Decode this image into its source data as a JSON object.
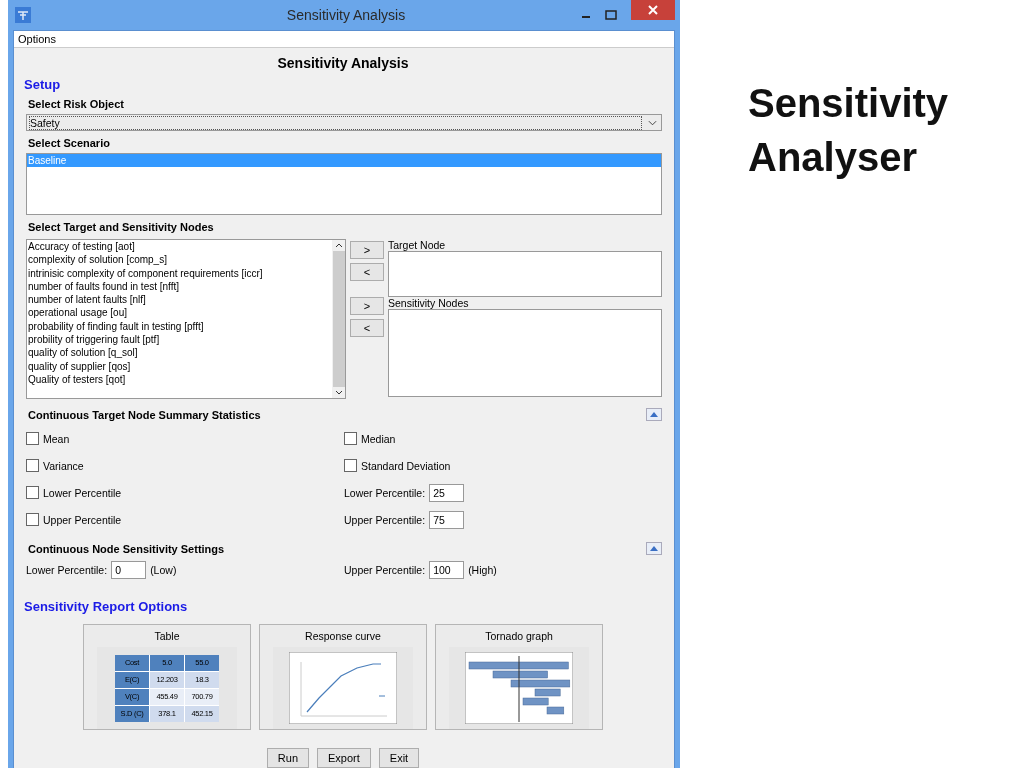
{
  "window": {
    "title": "Sensitivity Analysis"
  },
  "menu": [
    "Options"
  ],
  "heading": "Sensitivity Analysis",
  "setup": {
    "title": "Setup",
    "risk_object": {
      "label": "Select Risk Object",
      "value": "Safety"
    },
    "scenario": {
      "label": "Select Scenario",
      "items": [
        {
          "label": "Baseline",
          "selected": true
        }
      ]
    },
    "nodes_label": "Select Target and Sensitivity Nodes",
    "nodes": [
      "Accuracy of testing [aot]",
      "complexity of solution [comp_s]",
      "intrinisic complexity of component requirements [iccr]",
      "number of faults found in test [nfft]",
      "number of latent faults [nlf]",
      "operational usage [ou]",
      "probability of finding fault in testing [pfft]",
      "probility of triggering fault [ptf]",
      "quality of solution [q_sol]",
      "quality of supplier [qos]",
      "Quality of testers [qot]"
    ],
    "move_buttons": [
      ">",
      "<",
      ">",
      "<"
    ],
    "target_label": "Target Node",
    "sensitivity_label": "Sensitivity Nodes"
  },
  "summary": {
    "title": "Continuous Target Node Summary Statistics",
    "rows": [
      {
        "left": {
          "label": "Mean",
          "checked": false
        },
        "right": {
          "kind": "check",
          "label": "Median",
          "checked": false
        }
      },
      {
        "left": {
          "label": "Variance",
          "checked": false
        },
        "right": {
          "kind": "check",
          "label": "Standard Deviation",
          "checked": false
        }
      },
      {
        "left": {
          "label": "Lower Percentile",
          "checked": false
        },
        "right": {
          "kind": "field",
          "label": "Lower Percentile:",
          "value": "25"
        }
      },
      {
        "left": {
          "label": "Upper Percentile",
          "checked": false
        },
        "right": {
          "kind": "field",
          "label": "Upper Percentile:",
          "value": "75"
        }
      }
    ]
  },
  "settings": {
    "title": "Continuous Node Sensitivity Settings",
    "lower": {
      "label": "Lower Percentile:",
      "value": "0",
      "note": "(Low)"
    },
    "upper": {
      "label": "Upper Percentile:",
      "value": "100",
      "note": "(High)"
    }
  },
  "report": {
    "title": "Sensitivity Report Options",
    "options": [
      {
        "kind": "table",
        "label": "Table",
        "table": [
          [
            "Cost",
            "5.0",
            "55.0"
          ],
          [
            "E(C)",
            "12.203",
            "18.3"
          ],
          [
            "V(C)",
            "455.49",
            "700.79"
          ],
          [
            "S.D (C)",
            "378.1",
            "452.15"
          ]
        ]
      },
      {
        "kind": "curve",
        "label": "Response curve"
      },
      {
        "kind": "tornado",
        "label": "Tornado graph"
      }
    ]
  },
  "buttons": [
    "Run",
    "Export",
    "Exit"
  ],
  "slide_title": "Sensitivity Analyser"
}
